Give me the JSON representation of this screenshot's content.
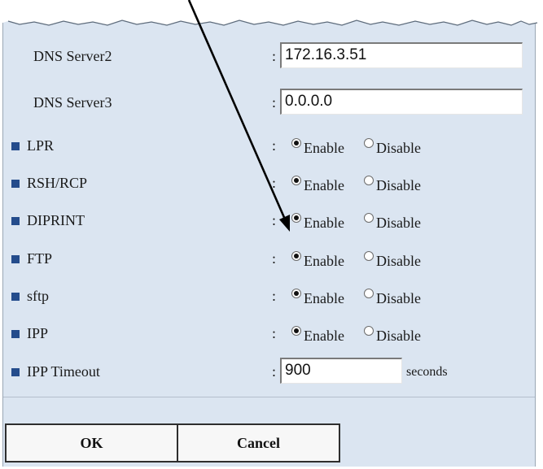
{
  "form": {
    "rows": [
      {
        "type": "text",
        "label": "DNS Server2",
        "value": "172.16.3.51",
        "bullet": false
      },
      {
        "type": "text",
        "label": "DNS Server3",
        "value": "0.0.0.0",
        "bullet": false
      },
      {
        "type": "toggle",
        "label": "LPR",
        "selected": "Enable",
        "bullet": true
      },
      {
        "type": "toggle",
        "label": "RSH/RCP",
        "selected": "Enable",
        "bullet": true
      },
      {
        "type": "toggle",
        "label": "DIPRINT",
        "selected": "Enable",
        "bullet": true
      },
      {
        "type": "toggle",
        "label": "FTP",
        "selected": "Enable",
        "bullet": true
      },
      {
        "type": "toggle",
        "label": "sftp",
        "selected": "Enable",
        "bullet": true
      },
      {
        "type": "toggle",
        "label": "IPP",
        "selected": "Enable",
        "bullet": true
      },
      {
        "type": "number",
        "label": "IPP Timeout",
        "value": "900",
        "units": "seconds",
        "bullet": true
      }
    ],
    "separator": ":",
    "enable_label": "Enable",
    "disable_label": "Disable"
  },
  "buttons": {
    "ok_label": "OK",
    "cancel_label": "Cancel"
  },
  "colors": {
    "panel_bg": "#dbe5f1",
    "bullet": "#244c8c"
  },
  "icons": {
    "bullet": "square-bullet-icon",
    "annotation": "annotation-arrow-icon"
  }
}
